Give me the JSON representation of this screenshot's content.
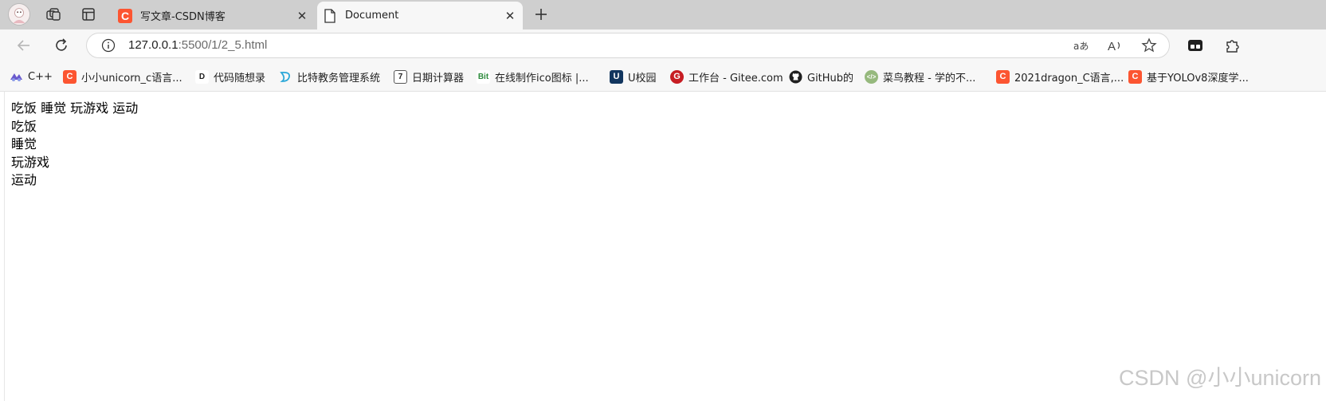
{
  "browser": {
    "tabs": [
      {
        "title": "写文章-CSDN博客",
        "favicon": "csdn-c-icon",
        "active": false
      },
      {
        "title": "Document",
        "favicon": "document-icon",
        "active": true
      }
    ],
    "address_bar": {
      "host": "127.0.0.1",
      "rest": ":5500/1/2_5.html"
    },
    "bookmarks": [
      {
        "label": "C++",
        "icon": "cpp-icon"
      },
      {
        "label": "小小unicorn_c语言...",
        "icon": "csdn-c-icon"
      },
      {
        "label": "代码随想录",
        "icon": "dmsxl-icon"
      },
      {
        "label": "比特教务管理系统",
        "icon": "bit-edu-icon"
      },
      {
        "label": "日期计算器",
        "icon": "calendar-icon"
      },
      {
        "label": "在线制作ico图标 |...",
        "icon": "bit-ico-icon"
      },
      {
        "label": "U校园",
        "icon": "u-campus-icon"
      },
      {
        "label": "工作台 - Gitee.com",
        "icon": "gitee-icon"
      },
      {
        "label": "GitHub的",
        "icon": "github-icon"
      },
      {
        "label": "菜鸟教程 - 学的不...",
        "icon": "runoob-icon"
      },
      {
        "label": "2021dragon_C语言,...",
        "icon": "csdn-c-icon"
      },
      {
        "label": "基于YOLOv8深度学...",
        "icon": "csdn-c-icon"
      }
    ],
    "colors": {
      "csdn_red": "#fc5531",
      "tabstrip": "#cfcfcf",
      "toolbar": "#f7f7f7"
    }
  },
  "page": {
    "first_line": "吃饭 睡觉 玩游戏 运动",
    "items": [
      "吃饭",
      "睡觉",
      "玩游戏",
      "运动"
    ],
    "watermark": "CSDN @小小unicorn"
  }
}
